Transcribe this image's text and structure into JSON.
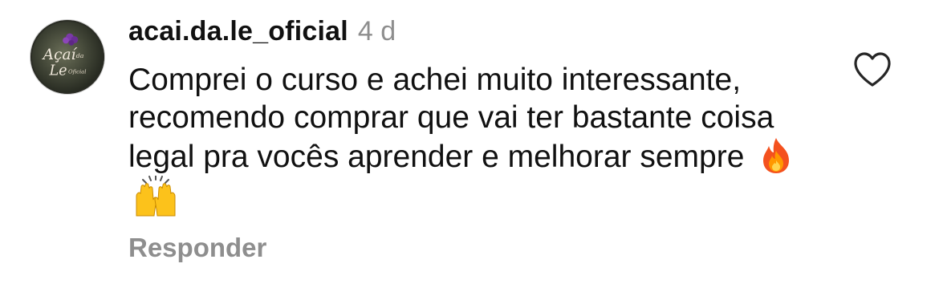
{
  "comment": {
    "username": "acai.da.le_oficial",
    "time_ago": "4 d",
    "text": "Comprei o curso e achei muito interessante, recomendo comprar que vai ter bastante coisa legal pra vocês aprender e melhorar sempre",
    "emojis": [
      "fire-emoji",
      "raising-hands-emoji"
    ],
    "reply_label": "Responder",
    "avatar_text": {
      "line1": "Açaí",
      "line2": "da",
      "line3": "Le",
      "line4": "Oficial"
    }
  },
  "icons": {
    "like": "heart-outline-icon"
  },
  "colors": {
    "primary_text": "#111111",
    "secondary_text": "#8e8e8e",
    "background": "#ffffff"
  }
}
